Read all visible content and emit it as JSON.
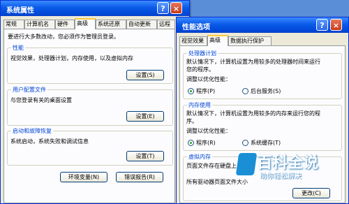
{
  "sysprop": {
    "title": "系统属性",
    "help_glyph": "?",
    "close_glyph": "×",
    "tabs": [
      "常规",
      "计算机名",
      "硬件",
      "高级",
      "系统还原",
      "自动更新",
      "远程"
    ],
    "admin_notice": "要进行大多数改动，您必须作为管理员登录。",
    "performance": {
      "label": "性能",
      "desc": "视觉效果，处理器计划，内存使用，以及虚拟内存",
      "button": "设置(S)"
    },
    "profiles": {
      "label": "用户配置文件",
      "desc": "与您登录有关的桌面设置",
      "button": "设置(E)"
    },
    "startup": {
      "label": "启动和故障恢复",
      "desc": "系统启动，系统失败和调试信息",
      "button": "设置(T)"
    },
    "env_button": "环境变量(N)",
    "error_button": "错误报告(R)"
  },
  "perf": {
    "title": "性能选项",
    "help_glyph": "?",
    "close_glyph": "×",
    "tabs": [
      "视觉效果",
      "高级",
      "数据执行保护"
    ],
    "processor": {
      "label": "处理器计划",
      "desc1": "默认情况下，计算机设置为用较多的处理器时间来运行",
      "desc2": "您的程序。",
      "adjust": "调整以优化性能：",
      "opt1": "程序(P)",
      "opt2": "后台服务(S)"
    },
    "memory": {
      "label": "内存使用",
      "desc1": "默认情况下，计算机设置为用较多的内存来运行您的程",
      "desc2": "序。",
      "adjust": "调整以优化性能：",
      "opt1": "程序(R)",
      "opt2": "系统缓存(T)"
    },
    "virtual": {
      "label": "虚拟内存",
      "desc1": "页面文件存在硬盘上，",
      "desc2": "所有驱动器页面文件大小",
      "button": "更改(C)"
    }
  },
  "watermark": {
    "main": "百科全说",
    "sub": "助你轻松解决"
  }
}
